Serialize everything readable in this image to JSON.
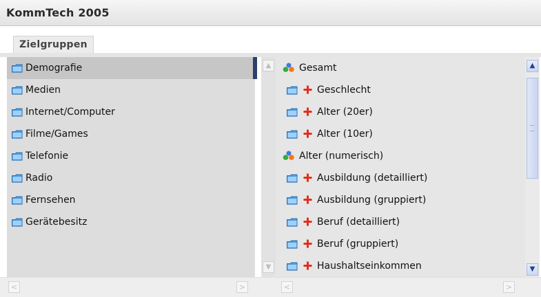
{
  "app": {
    "title": "KommTech 2005"
  },
  "tabs": [
    {
      "label": "Zielgruppen"
    }
  ],
  "left_list": {
    "items": [
      {
        "label": "Demografie",
        "selected": true,
        "icon": "folder-icon"
      },
      {
        "label": "Medien",
        "icon": "folder-icon"
      },
      {
        "label": "Internet/Computer",
        "icon": "folder-icon"
      },
      {
        "label": "Filme/Games",
        "icon": "folder-icon"
      },
      {
        "label": "Telefonie",
        "icon": "folder-icon"
      },
      {
        "label": "Radio",
        "icon": "folder-icon"
      },
      {
        "label": "Fernsehen",
        "icon": "folder-icon"
      },
      {
        "label": "Gerätebesitz",
        "icon": "folder-icon"
      }
    ]
  },
  "right_list": {
    "items": [
      {
        "label": "Gesamt",
        "type": "variable",
        "icon": "people-icon"
      },
      {
        "label": "Geschlecht",
        "type": "group",
        "icon": "folder-icon"
      },
      {
        "label": "Alter (20er)",
        "type": "group",
        "icon": "folder-icon"
      },
      {
        "label": "Alter (10er)",
        "type": "group",
        "icon": "folder-icon"
      },
      {
        "label": "Alter (numerisch)",
        "type": "variable",
        "icon": "people-icon"
      },
      {
        "label": "Ausbildung (detailliert)",
        "type": "group",
        "icon": "folder-icon"
      },
      {
        "label": "Ausbildung (gruppiert)",
        "type": "group",
        "icon": "folder-icon"
      },
      {
        "label": "Beruf (detailliert)",
        "type": "group",
        "icon": "folder-icon"
      },
      {
        "label": "Beruf (gruppiert)",
        "type": "group",
        "icon": "folder-icon"
      },
      {
        "label": "Haushaltseinkommen",
        "type": "group",
        "icon": "folder-icon"
      }
    ]
  },
  "colors": {
    "selection": "#c6c6c6",
    "divider": "#2c3f6d",
    "plus": "#e0301e",
    "folder": "#5aa7e6"
  }
}
